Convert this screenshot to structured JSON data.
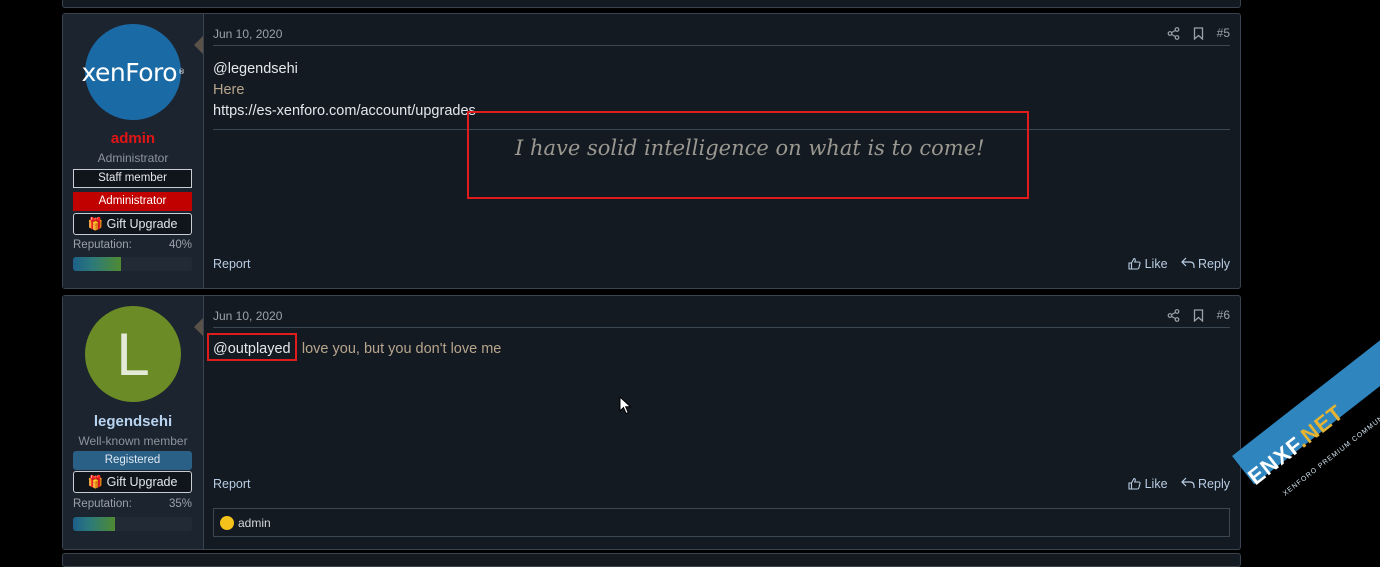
{
  "posts": [
    {
      "date": "Jun 10, 2020",
      "number": "#5",
      "user": {
        "avatar_text": "xenForo",
        "name": "admin",
        "title": "Administrator",
        "badges": [
          "Staff member",
          "Administrator"
        ],
        "gift_label": "Gift Upgrade",
        "reputation_label": "Reputation:",
        "reputation_pct": "40%",
        "reputation_value": 0.4
      },
      "message": {
        "mention": "@legendsehi",
        "line2": "Here",
        "line3": "https://es-xenforo.com/account/upgrades"
      },
      "signature": "I have solid intelligence on what is to come!",
      "footer": {
        "report": "Report",
        "like": "Like",
        "reply": "Reply"
      }
    },
    {
      "date": "Jun 10, 2020",
      "number": "#6",
      "user": {
        "avatar_text": "L",
        "name": "legendsehi",
        "title": "Well-known member",
        "badges": [
          "Registered"
        ],
        "gift_label": "Gift Upgrade",
        "reputation_label": "Reputation:",
        "reputation_pct": "35%",
        "reputation_value": 0.35
      },
      "message": {
        "mention": "@outplayed",
        "text": " i love you, but you don't love me"
      },
      "footer": {
        "report": "Report",
        "like": "Like",
        "reply": "Reply"
      },
      "reactions": {
        "user": "admin"
      }
    }
  ],
  "watermark": {
    "brand": "ENXF",
    "tld": ".NET",
    "tagline": "XENFORO PREMIUM COMMUNITY"
  },
  "colors": {
    "highlight": "#e01c1c",
    "admin_name": "#e21515",
    "link": "#b8cde4"
  }
}
